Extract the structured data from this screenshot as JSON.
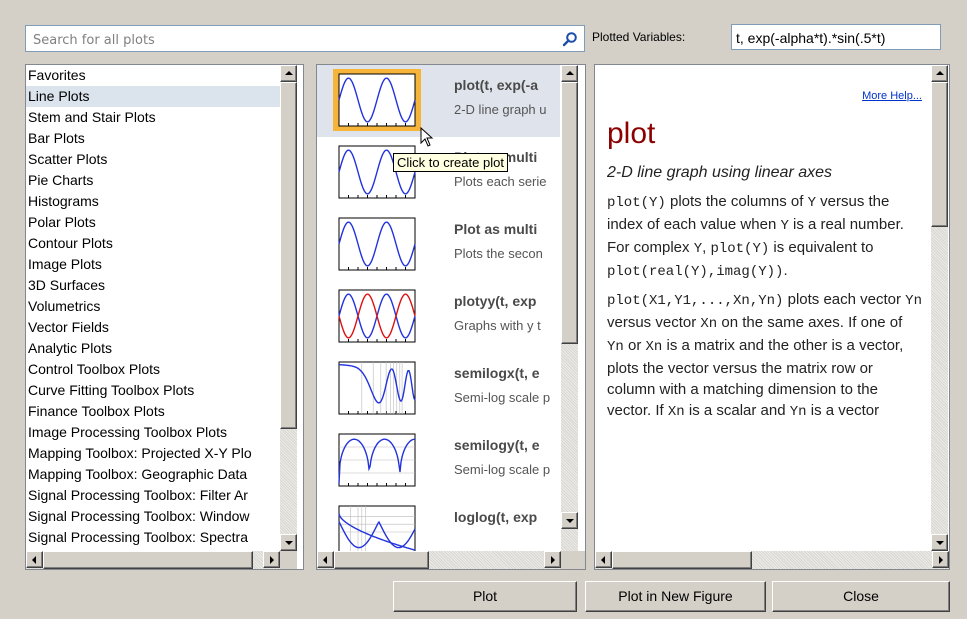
{
  "search": {
    "placeholder": "Search for all plots"
  },
  "plotted_variables": {
    "label": "Plotted Variables:",
    "value": "t, exp(-alpha*t).*sin(.5*t)"
  },
  "categories": [
    {
      "label": "Favorites"
    },
    {
      "label": "Line Plots",
      "selected": true
    },
    {
      "label": "Stem and Stair Plots"
    },
    {
      "label": "Bar Plots"
    },
    {
      "label": "Scatter Plots"
    },
    {
      "label": "Pie Charts"
    },
    {
      "label": "Histograms"
    },
    {
      "label": "Polar Plots"
    },
    {
      "label": "Contour Plots"
    },
    {
      "label": "Image Plots"
    },
    {
      "label": "3D Surfaces"
    },
    {
      "label": "Volumetrics"
    },
    {
      "label": "Vector Fields"
    },
    {
      "label": "Analytic Plots"
    },
    {
      "label": "Control Toolbox Plots"
    },
    {
      "label": "Curve Fitting Toolbox Plots"
    },
    {
      "label": "Finance Toolbox Plots"
    },
    {
      "label": "Image Processing Toolbox Plots"
    },
    {
      "label": "Mapping Toolbox: Projected X-Y Plo"
    },
    {
      "label": "Mapping Toolbox: Geographic Data"
    },
    {
      "label": "Signal Processing Toolbox: Filter Ar"
    },
    {
      "label": "Signal Processing Toolbox: Window"
    },
    {
      "label": "Signal Processing Toolbox: Spectra"
    }
  ],
  "plots": [
    {
      "name": "plot(t, exp(-a",
      "desc": "2-D line graph u",
      "thumb": "sine"
    },
    {
      "name": "Plot as multi",
      "desc": "Plots each serie",
      "thumb": "sine"
    },
    {
      "name": "Plot as multi",
      "desc": "Plots the secon",
      "thumb": "sine"
    },
    {
      "name": "plotyy(t, exp",
      "desc": "Graphs with y t",
      "thumb": "plotyy"
    },
    {
      "name": "semilogx(t, e",
      "desc": "Semi-log scale p",
      "thumb": "semilogx"
    },
    {
      "name": "semilogy(t, e",
      "desc": "Semi-log scale p",
      "thumb": "semilogy"
    },
    {
      "name": "loglog(t, exp",
      "desc": "",
      "thumb": "loglog"
    }
  ],
  "tooltip": "Click to create plot",
  "help": {
    "more_link": "More Help...",
    "title": "plot",
    "subtitle": "2-D line graph using linear axes",
    "para1": [
      {
        "t": "plot(Y)",
        "mono": true
      },
      {
        "t": " plots the columns of "
      },
      {
        "t": "Y",
        "mono": true
      },
      {
        "t": " versus the index of each value when "
      },
      {
        "t": "Y",
        "mono": true
      },
      {
        "t": " is a real number. For complex "
      },
      {
        "t": "Y",
        "mono": true
      },
      {
        "t": ", "
      },
      {
        "t": "plot(Y)",
        "mono": true
      },
      {
        "t": " is equivalent to "
      },
      {
        "t": "plot(real(Y),imag(Y))",
        "mono": true
      },
      {
        "t": "."
      }
    ],
    "para2": [
      {
        "t": "plot(X1,Y1,...,Xn,Yn)",
        "mono": true
      },
      {
        "t": " plots each vector "
      },
      {
        "t": "Yn",
        "mono": true
      },
      {
        "t": " versus vector "
      },
      {
        "t": "Xn",
        "mono": true
      },
      {
        "t": " on the same axes. If one of "
      },
      {
        "t": "Yn",
        "mono": true
      },
      {
        "t": " or "
      },
      {
        "t": "Xn",
        "mono": true
      },
      {
        "t": " is a matrix and the other is a vector, plots the vector versus the matrix row or column with a matching dimension to the vector. "
      },
      {
        "t": "If "
      },
      {
        "t": "Xn",
        "mono": true
      },
      {
        "t": " is a scalar and "
      },
      {
        "t": "Yn",
        "mono": true
      },
      {
        "t": " is a vector"
      }
    ]
  },
  "buttons": {
    "plot": "Plot",
    "plot_new": "Plot in New Figure",
    "close": "Close"
  },
  "colors": {
    "selection": "#dbe3ec",
    "link": "#0033cc",
    "title": "#8b0000",
    "thumb_hi": "#f7b43a"
  }
}
